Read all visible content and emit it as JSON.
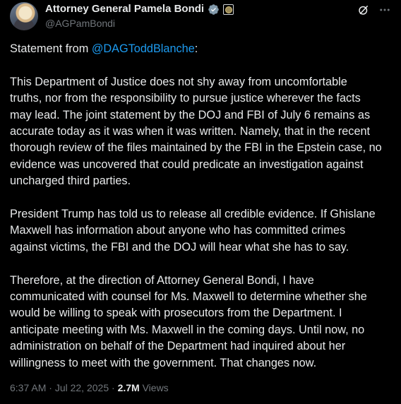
{
  "author": {
    "display_name": "Attorney General Pamela Bondi",
    "handle": "@AGPamBondi",
    "verified_color": "#829aab"
  },
  "post": {
    "intro_prefix": "Statement from ",
    "mention": "@DAGToddBlanche",
    "intro_suffix": ":",
    "paragraphs": [
      "This Department of Justice does not shy away from uncomfortable\ntruths, nor from the responsibility to pursue justice wherever the facts\nmay lead.  The joint statement by the DOJ and FBI of July 6 remains as\naccurate today as it was when it was written.  Namely, that in the recent\nthorough review of the files maintained by the FBI in the Epstein case, no\nevidence was uncovered that could predicate an investigation against\nuncharged third parties.",
      "President Trump has told us to release all credible evidence. If Ghislane\nMaxwell has information about anyone who has committed crimes\nagainst victims, the FBI and the DOJ will hear what she has to say.",
      "Therefore, at the direction of Attorney General Bondi, I have\ncommunicated with counsel for Ms. Maxwell to determine whether she\nwould be willing to speak with prosecutors from the Department.  I\nanticipate meeting with Ms. Maxwell in the coming days.  Until now, no\nadministration on behalf of the Department had inquired about her\nwillingness to meet with the government.  That changes now."
    ]
  },
  "meta": {
    "time": "6:37 AM",
    "separator": " · ",
    "date": "Jul 22, 2025",
    "separator2": " · ",
    "views_count": "2.7M",
    "views_label": " Views"
  },
  "colors": {
    "background": "#000000",
    "text": "#e7e9ea",
    "secondary": "#71767b",
    "link": "#1d9bf0"
  }
}
